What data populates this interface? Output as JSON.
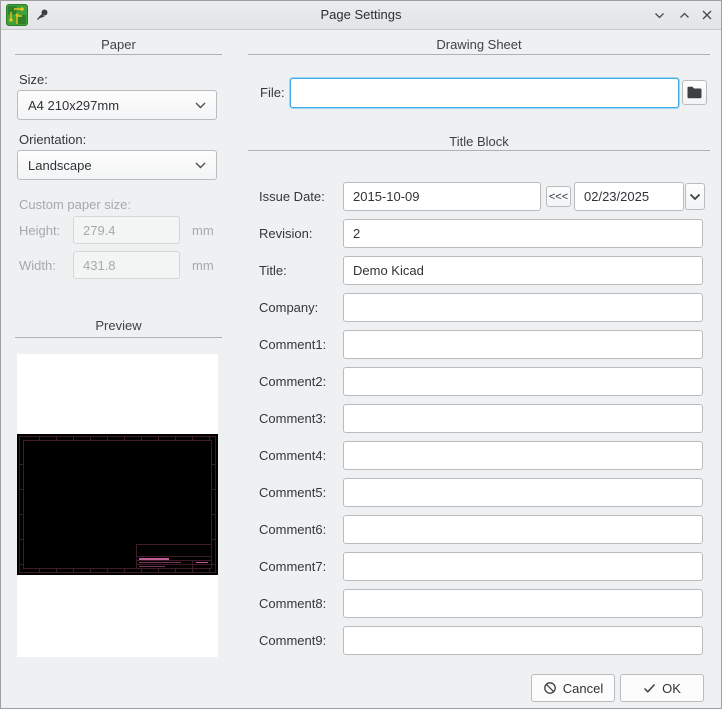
{
  "window": {
    "title": "Page Settings"
  },
  "icons": {
    "kicad_logo": "green-pcb-logo",
    "pin": "pushpin",
    "shade": "chevron-down",
    "maximize": "chevron-up",
    "close": "x-cross",
    "folder": "folder",
    "select_arrow": "chevron-down",
    "date_dropdown": "chevron-down",
    "cancel": "slashed-circle",
    "ok": "checkmark"
  },
  "paper": {
    "section_title": "Paper",
    "size_label": "Size:",
    "size_value": "A4 210x297mm",
    "orientation_label": "Orientation:",
    "orientation_value": "Landscape",
    "custom_size_label": "Custom paper size:",
    "height_label": "Height:",
    "height_value": "279.4",
    "height_unit": "mm",
    "width_label": "Width:",
    "width_value": "431.8",
    "width_unit": "mm"
  },
  "preview": {
    "section_title": "Preview"
  },
  "drawing_sheet": {
    "section_title": "Drawing Sheet",
    "file_label": "File:",
    "file_value": ""
  },
  "title_block": {
    "section_title": "Title Block",
    "issue_date_label": "Issue Date:",
    "issue_date_value": "2015-10-09",
    "copy_date_button": "<<<",
    "date_picker_value": "02/23/2025",
    "revision_label": "Revision:",
    "revision_value": "2",
    "title_label": "Title:",
    "title_value": "Demo Kicad",
    "company_label": "Company:",
    "company_value": "",
    "comments": [
      {
        "label": "Comment1:",
        "value": ""
      },
      {
        "label": "Comment2:",
        "value": ""
      },
      {
        "label": "Comment3:",
        "value": ""
      },
      {
        "label": "Comment4:",
        "value": ""
      },
      {
        "label": "Comment5:",
        "value": ""
      },
      {
        "label": "Comment6:",
        "value": ""
      },
      {
        "label": "Comment7:",
        "value": ""
      },
      {
        "label": "Comment8:",
        "value": ""
      },
      {
        "label": "Comment9:",
        "value": ""
      }
    ]
  },
  "actions": {
    "cancel_label": "Cancel",
    "ok_label": "OK"
  },
  "colors": {
    "focus_border": "#3daee9",
    "dialog_bg": "#eff0f1",
    "preview_paper": "#ffffff",
    "preview_sheet_bg": "#000000",
    "preview_frame_line": "#3f1b29",
    "preview_text_bright": "#bd5f93"
  }
}
